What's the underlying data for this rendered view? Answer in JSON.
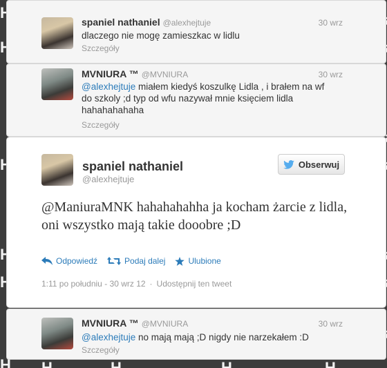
{
  "background": {
    "right_letters": [
      "Ha",
      "Ha",
      "Ha",
      "Ha",
      "Ha",
      "Ha",
      "Ha",
      "Ha",
      "Ha",
      "Ha"
    ],
    "left_letters": [
      "H",
      "H",
      "H",
      "H",
      "H",
      "H",
      "H",
      "H",
      "H",
      "H"
    ]
  },
  "replies_top": [
    {
      "name": "spaniel nathaniel",
      "handle": "@alexhejtuje",
      "time": "30 wrz",
      "text": "dlaczego nie mogę zamieszkac w lidlu",
      "details": "Szczegóły"
    },
    {
      "name": "MVNIURA ™",
      "handle": "@MVNIURA",
      "time": "30 wrz",
      "mention": "@alexhejtuje",
      "text": " miałem kiedyś koszulkę Lidla , i brałem na wf do szkoly ;d typ od wfu nazywał mnie księciem lidla hahahahahaha",
      "details": "Szczegóły"
    }
  ],
  "main_tweet": {
    "name": "spaniel nathaniel",
    "handle": "@alexhejtuje",
    "follow_label": "Obserwuj",
    "text": "@ManiuraMNK hahahahahha ja kocham żarcie z lidla, oni wszystko mają takie dooobre ;D",
    "actions": {
      "reply": "Odpowiedź",
      "retweet": "Podaj dalej",
      "favorite": "Ulubione"
    },
    "timestamp": "1:11 po południu - 30 wrz 12",
    "share": "Udostępnij ten tweet"
  },
  "reply_bottom": {
    "name": "MVNIURA ™",
    "handle": "@MVNIURA",
    "time": "30 wrz",
    "mention": "@alexhejtuje",
    "text": " no mają mają ;D nigdy nie narzekałem :D",
    "details": "Szczegóły"
  },
  "colors": {
    "link": "#2b7bb9",
    "twitter_bird": "#55acee",
    "background": "#3c3c3c"
  }
}
